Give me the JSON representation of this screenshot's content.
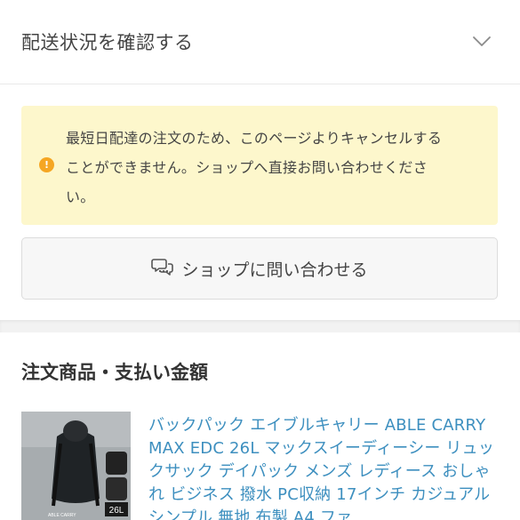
{
  "shipping": {
    "title": "配送状況を確認する",
    "chevron_icon": "chevron-down-icon"
  },
  "notice": {
    "icon": "info-dot-icon",
    "icon_color": "#f5a623",
    "background": "#fdf7cc",
    "line1": "最短日配達の注文のため、このページよりキャンセルする",
    "line2": "ことができません。ショップへ直接お問い合わせくださ",
    "line3": "い。"
  },
  "contact_button": {
    "icon": "chat-bubbles-icon",
    "label": "ショップに問い合わせる"
  },
  "order_section": {
    "title": "注文商品・支払い金額",
    "product": {
      "title": "バックパック エイブルキャリー ABLE CARRY MAX EDC 26L マックスイーディーシー リュックサック デイパック メンズ レディース おしゃれ ビジネス 撥水 PC収納 17インチ カジュアル シンプル 無地 布製 A4 ファ",
      "image_badge": "26L",
      "image_brand": "ABLE CARRY",
      "link_color": "#3d8fbf"
    }
  }
}
